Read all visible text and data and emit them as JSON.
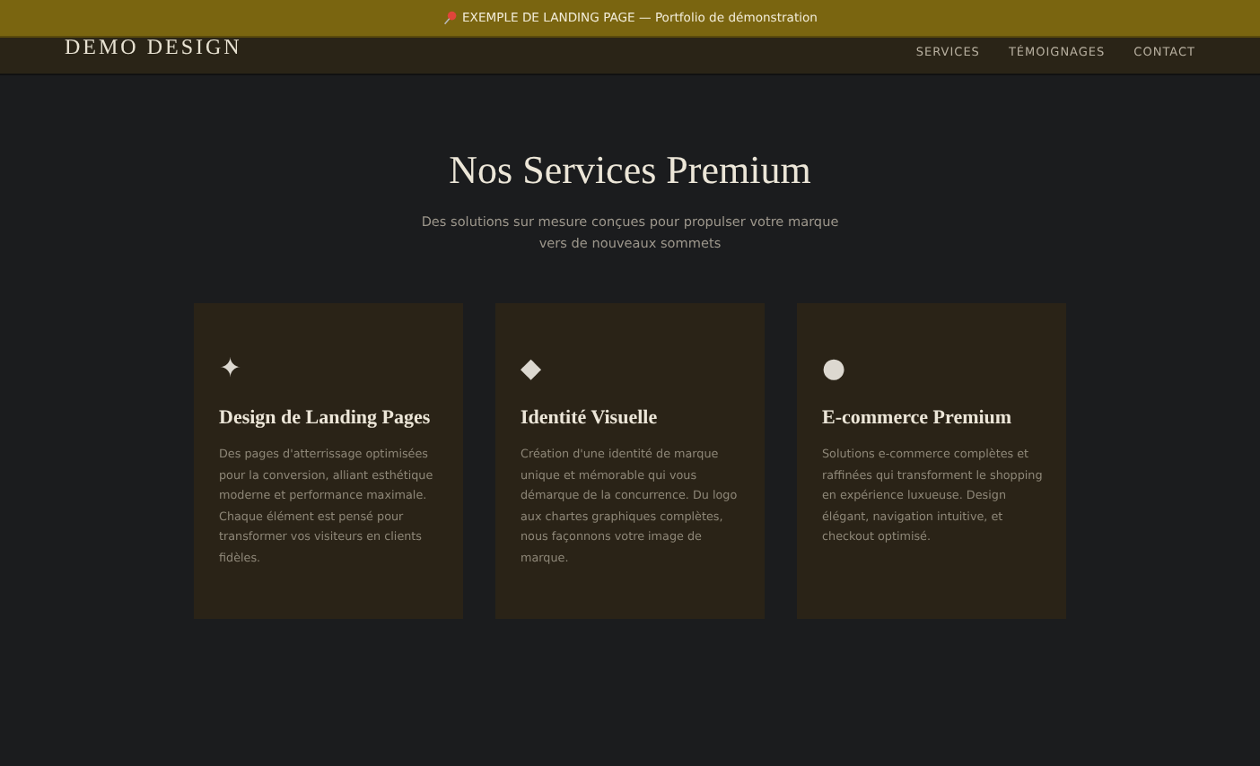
{
  "banner": {
    "text": "EXEMPLE DE LANDING PAGE — Portfolio de démonstration"
  },
  "header": {
    "logo": "DEMO DESIGN",
    "nav": [
      "SERVICES",
      "TÉMOIGNAGES",
      "CONTACT"
    ]
  },
  "section": {
    "title": "Nos Services Premium",
    "subtitle": "Des solutions sur mesure conçues pour propulser votre marque vers de nouveaux sommets"
  },
  "cards": [
    {
      "icon": "✦",
      "title": "Design de Landing Pages",
      "text": "Des pages d'atterrissage optimisées pour la conversion, alliant esthétique moderne et performance maximale. Chaque élément est pensé pour transformer vos visiteurs en clients fidèles."
    },
    {
      "icon": "◆",
      "title": "Identité Visuelle",
      "text": "Création d'une identité de marque unique et mémorable qui vous démarque de la concurrence. Du logo aux chartes graphiques complètes, nous façonnons votre image de marque."
    },
    {
      "icon": "●",
      "title": "E-commerce Premium",
      "text": "Solutions e-commerce complètes et raffinées qui transforment le shopping en expérience luxueuse. Design élégant, navigation intuitive, et checkout optimisé."
    }
  ]
}
